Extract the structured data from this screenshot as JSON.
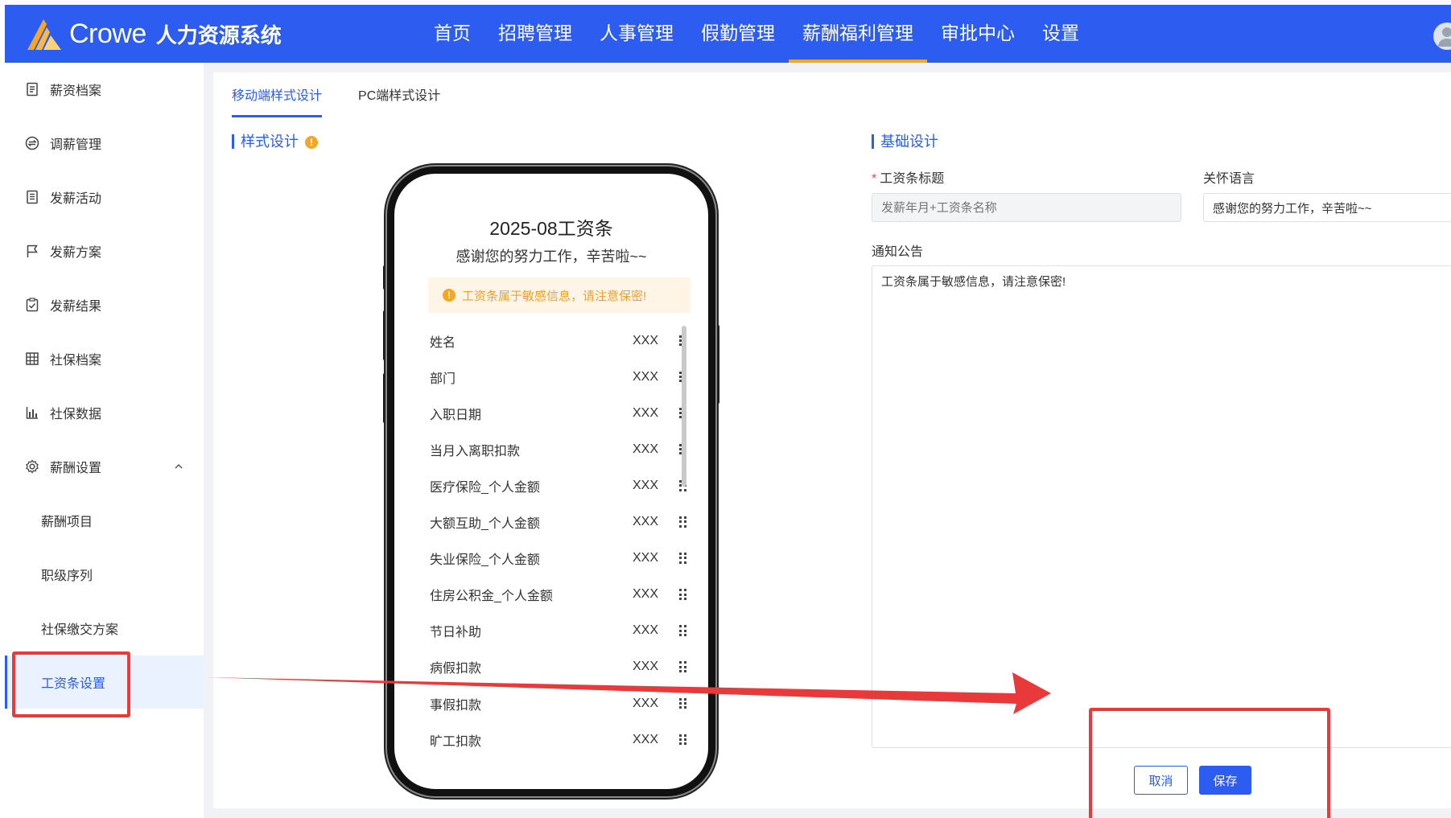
{
  "header": {
    "brand_en": "Crowe",
    "brand_cn": "人力资源系统",
    "nav": [
      "首页",
      "招聘管理",
      "人事管理",
      "假勤管理",
      "薪酬福利管理",
      "审批中心",
      "设置"
    ],
    "active_nav": "薪酬福利管理"
  },
  "sidebar": {
    "items": [
      {
        "label": "薪资档案",
        "icon": "file-icon"
      },
      {
        "label": "调薪管理",
        "icon": "exchange-icon"
      },
      {
        "label": "发薪活动",
        "icon": "document-list-icon"
      },
      {
        "label": "发薪方案",
        "icon": "flag-icon"
      },
      {
        "label": "发薪结果",
        "icon": "clipboard-check-icon"
      },
      {
        "label": "社保档案",
        "icon": "building-icon"
      },
      {
        "label": "社保数据",
        "icon": "bar-chart-icon"
      },
      {
        "label": "薪酬设置",
        "icon": "gear-icon"
      }
    ],
    "sub_items": [
      "薪酬项目",
      "职级序列",
      "社保缴交方案",
      "工资条设置"
    ],
    "active_sub": "工资条设置"
  },
  "tabs": [
    "移动端样式设计",
    "PC端样式设计"
  ],
  "active_tab": "移动端样式设计",
  "style_section": {
    "title": "样式设计",
    "info_icon": "!"
  },
  "phone": {
    "title": "2025-08工资条",
    "subtitle": "感谢您的努力工作，辛苦啦~~",
    "notice": "工资条属于敏感信息，请注意保密!",
    "rows": [
      {
        "label": "姓名",
        "value": "XXX"
      },
      {
        "label": "部门",
        "value": "XXX"
      },
      {
        "label": "入职日期",
        "value": "XXX"
      },
      {
        "label": "当月入离职扣款",
        "value": "XXX"
      },
      {
        "label": "医疗保险_个人金额",
        "value": "XXX"
      },
      {
        "label": "大额互助_个人金额",
        "value": "XXX"
      },
      {
        "label": "失业保险_个人金额",
        "value": "XXX"
      },
      {
        "label": "住房公积金_个人金额",
        "value": "XXX"
      },
      {
        "label": "节日补助",
        "value": "XXX"
      },
      {
        "label": "病假扣款",
        "value": "XXX"
      },
      {
        "label": "事假扣款",
        "value": "XXX"
      },
      {
        "label": "旷工扣款",
        "value": "XXX"
      }
    ]
  },
  "form": {
    "section_title": "基础设计",
    "title_label": "工资条标题",
    "title_placeholder": "发薪年月+工资条名称",
    "care_label": "关怀语言",
    "care_value": "感谢您的努力工作，辛苦啦~~",
    "notice_label": "通知公告",
    "notice_value": "工资条属于敏感信息，请注意保密!",
    "cancel": "取消",
    "save": "保存"
  },
  "colors": {
    "primary": "#2c5cf0",
    "accent": "#f5a623",
    "annotation": "#e83a3a"
  }
}
